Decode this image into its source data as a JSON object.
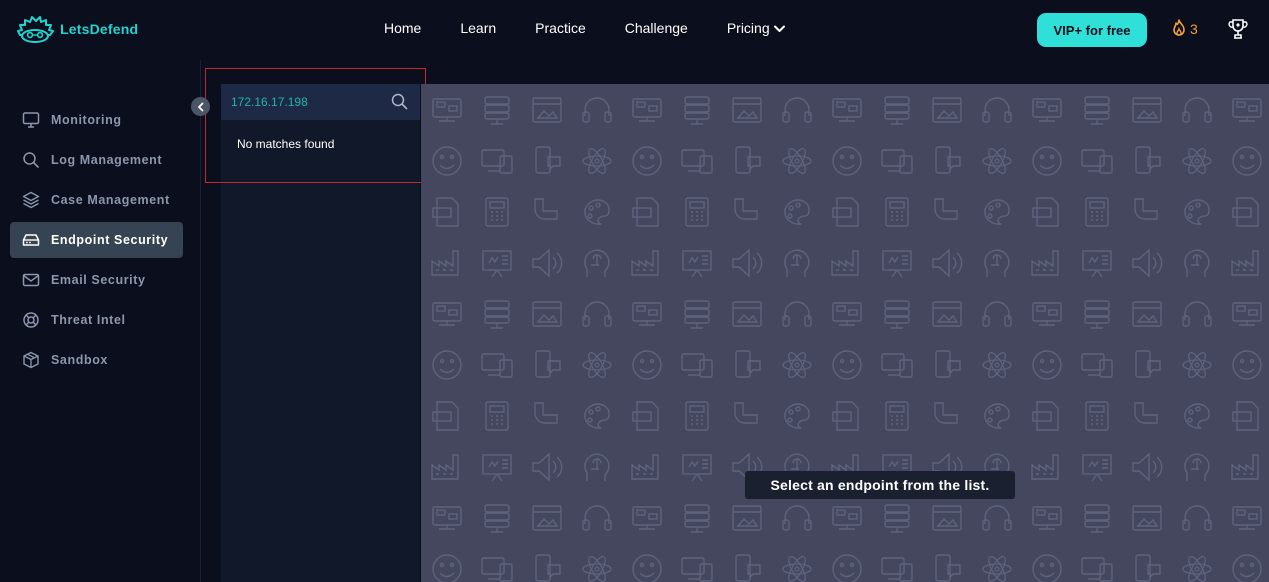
{
  "brand": {
    "name": "LetsDefend"
  },
  "nav": {
    "items": [
      {
        "label": "Home"
      },
      {
        "label": "Learn"
      },
      {
        "label": "Practice"
      },
      {
        "label": "Challenge"
      },
      {
        "label": "Pricing",
        "has_dropdown": true
      }
    ]
  },
  "header": {
    "vip_label": "VIP+ for free",
    "streak_count": "3",
    "icons": [
      "fire-icon",
      "trophy-icon"
    ]
  },
  "sidebar": {
    "items": [
      {
        "label": "Monitoring",
        "icon": "monitor-icon"
      },
      {
        "label": "Log Management",
        "icon": "search-icon"
      },
      {
        "label": "Case Management",
        "icon": "layers-icon"
      },
      {
        "label": "Endpoint Security",
        "icon": "drive-icon",
        "active": true
      },
      {
        "label": "Email Security",
        "icon": "mail-icon"
      },
      {
        "label": "Threat Intel",
        "icon": "lifebuoy-icon"
      },
      {
        "label": "Sandbox",
        "icon": "box-icon"
      }
    ]
  },
  "endpoint_list": {
    "search_value": "172.16.17.198",
    "empty_message": "No matches found"
  },
  "main": {
    "prompt": "Select an endpoint from the list."
  },
  "colors": {
    "accent": "#2ee0d8",
    "brand_text": "#21d4d0",
    "background": "#0b0e1c",
    "active_item": "#364352",
    "pattern_bg": "#44475e",
    "streak": "#f59e3b",
    "highlight": "#c0282e"
  }
}
